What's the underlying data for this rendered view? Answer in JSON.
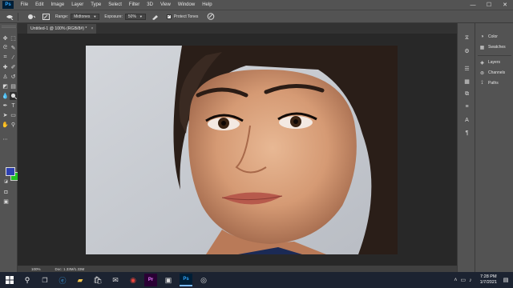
{
  "app": {
    "logo_text": "Ps"
  },
  "menu": [
    "File",
    "Edit",
    "Image",
    "Layer",
    "Type",
    "Select",
    "Filter",
    "3D",
    "View",
    "Window",
    "Help"
  ],
  "window_controls": {
    "minimize": "—",
    "maximize": "☐",
    "close": "✕"
  },
  "options": {
    "range_label": "Range:",
    "range_value": "Midtones",
    "exposure_label": "Exposure:",
    "exposure_value": "50%",
    "protect_tones_label": "Protect Tones",
    "protect_tones_checked": true
  },
  "document": {
    "tab_title": "Untitled-1 @ 100% (RGB/8#) *",
    "tab_close": "×"
  },
  "status": {
    "zoom": "100%",
    "doc_size": "Doc: 1.33M/1.33M"
  },
  "swatches": {
    "foreground": "#2d3fb0",
    "background": "#21c021"
  },
  "panels": {
    "group1": [
      "Color",
      "Swatches"
    ],
    "group2": [
      "Layers",
      "Channels",
      "Paths"
    ]
  },
  "taskbar": {
    "clock_time": "7:28 PM",
    "clock_date": "1/7/2021",
    "apps": [
      "file-explorer",
      "edge",
      "folder",
      "store",
      "mail",
      "chrome",
      "premiere",
      "media",
      "photoshop",
      "obs"
    ]
  },
  "colors": {
    "chrome_bg": "#535353",
    "canvas_bg": "#282828",
    "taskbar_bg": "#1c2331",
    "ps_accent": "#31a8ff"
  }
}
